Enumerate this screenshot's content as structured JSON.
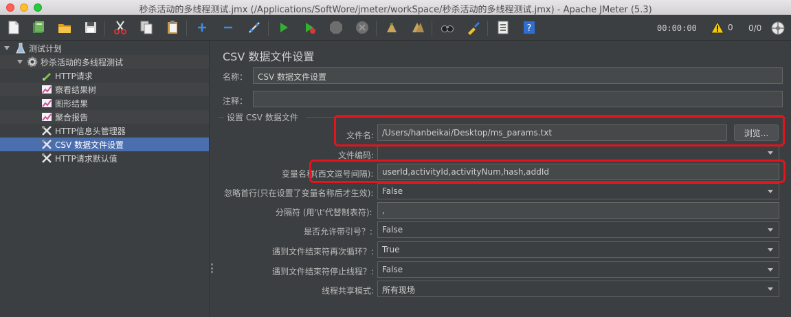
{
  "window": {
    "title": "秒杀活动的多线程测试.jmx (/Applications/SoftWore/jmeter/workSpace/秒杀活动的多线程测试.jmx) - Apache JMeter (5.3)"
  },
  "toolbar": {
    "timer": "00:00:00",
    "warnings": "0",
    "threads": "0/0"
  },
  "tree": {
    "items": [
      {
        "label": "测试计划",
        "icon": "flask-icon"
      },
      {
        "label": "秒杀活动的多线程测试",
        "icon": "gear-icon"
      },
      {
        "label": "HTTP请求",
        "icon": "pen-icon"
      },
      {
        "label": "察看结果树",
        "icon": "graph-icon"
      },
      {
        "label": "图形结果",
        "icon": "graph-icon"
      },
      {
        "label": "聚合报告",
        "icon": "graph-icon"
      },
      {
        "label": "HTTP信息头管理器",
        "icon": "tools-icon"
      },
      {
        "label": "CSV 数据文件设置",
        "icon": "tools-icon"
      },
      {
        "label": "HTTP请求默认值",
        "icon": "tools-icon"
      }
    ]
  },
  "panel": {
    "heading": "CSV 数据文件设置",
    "name_label": "名称：",
    "name_value": "CSV 数据文件设置",
    "comment_label": "注释：",
    "comment_value": "",
    "group_title": "设置 CSV 数据文件",
    "filename_label": "文件名:",
    "filename_value": "/Users/hanbeikai/Desktop/ms_params.txt",
    "browse_label": "浏览...",
    "encoding_label": "文件编码:",
    "encoding_value": "",
    "varnames_label": "变量名称(西文逗号间隔):",
    "varnames_value": "userId,activityId,activityNum,hash,addId",
    "ignore_first_label": "忽略首行(只在设置了变量名称后才生效):",
    "ignore_first_value": "False",
    "delimiter_label": "分隔符 (用'\\t'代替制表符):",
    "delimiter_value": ",",
    "quoted_label": "是否允许带引号？:",
    "quoted_value": "False",
    "recycle_label": "遇到文件结束符再次循环？:",
    "recycle_value": "True",
    "stop_label": "遇到文件结束符停止线程？:",
    "stop_value": "False",
    "share_label": "线程共享模式:",
    "share_value": "所有现场"
  },
  "colors": {
    "highlight": "#e5131b",
    "selection": "#4b6eaf"
  }
}
